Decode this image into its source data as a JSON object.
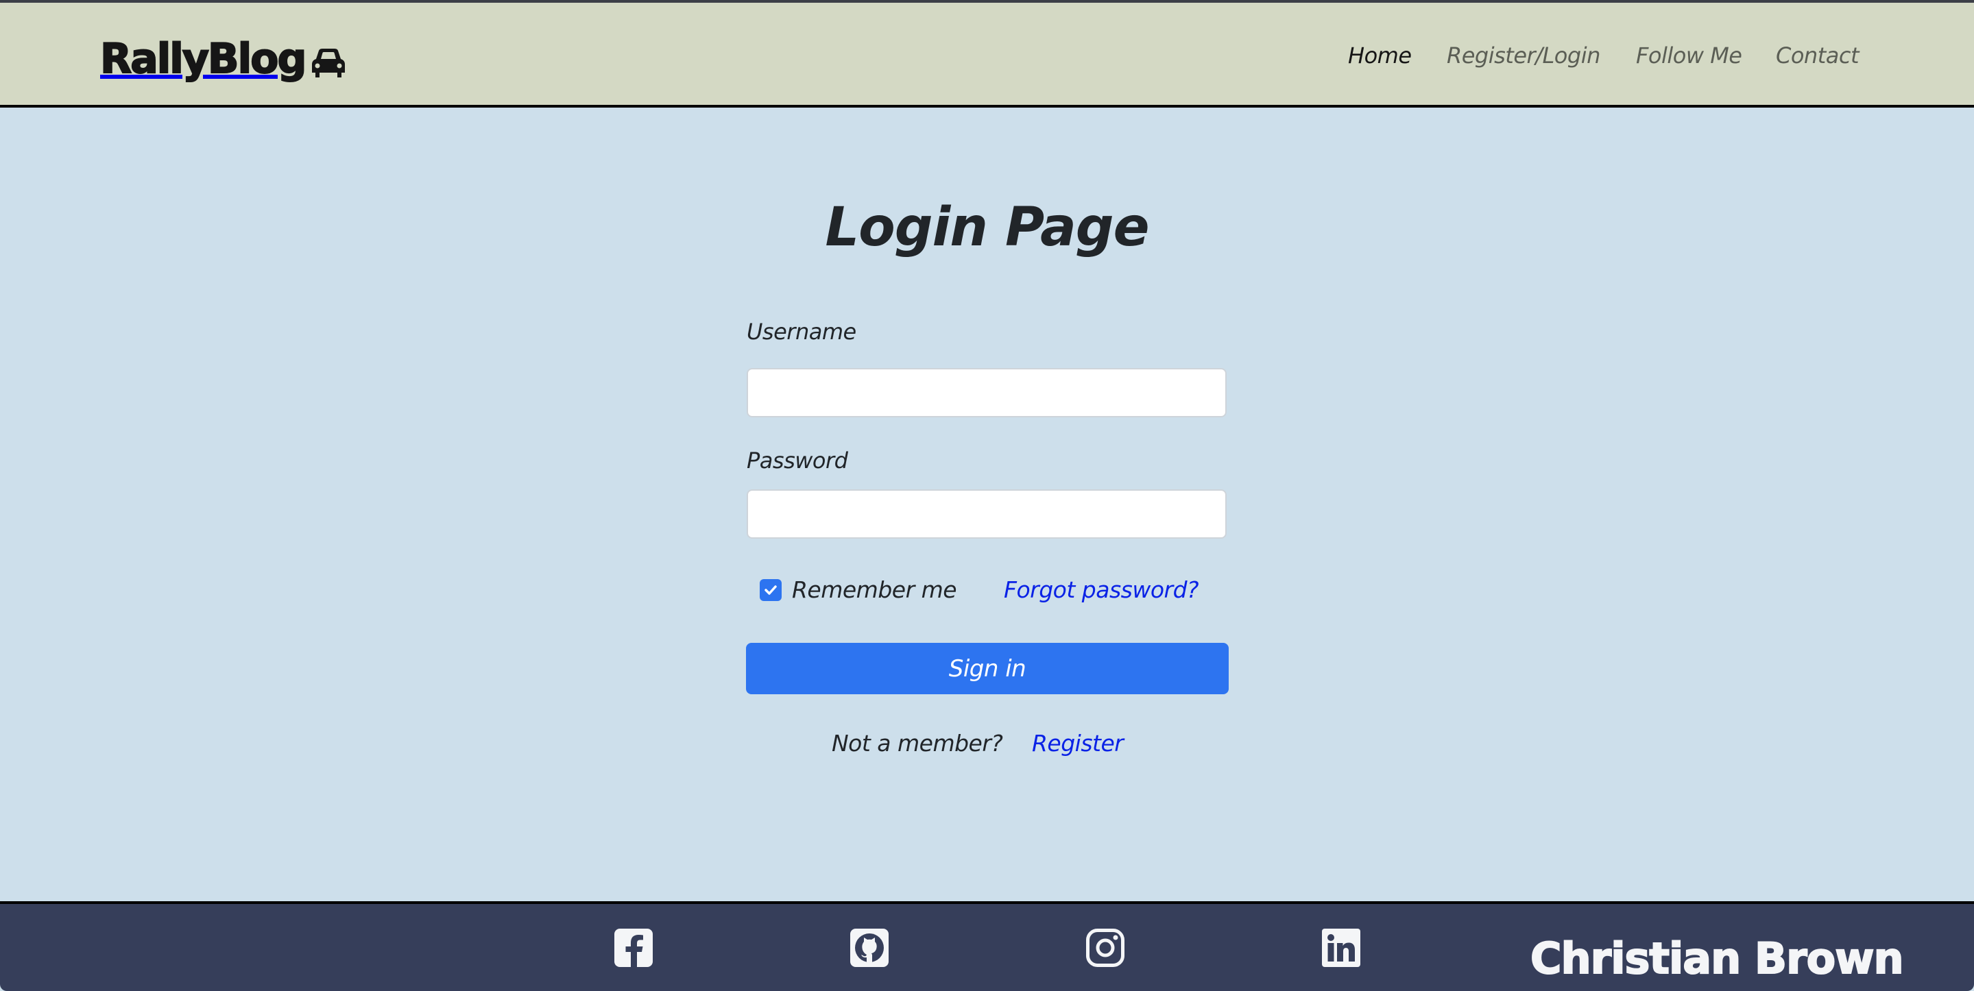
{
  "header": {
    "logo_text": "RallyBlog",
    "logo_icon": "car-icon",
    "nav": [
      {
        "label": "Home",
        "active": true
      },
      {
        "label": "Register/Login",
        "active": false
      },
      {
        "label": "Follow Me",
        "active": false
      },
      {
        "label": "Contact",
        "active": false
      }
    ]
  },
  "main": {
    "title": "Login Page",
    "username": {
      "label": "Username",
      "value": "",
      "placeholder": ""
    },
    "password": {
      "label": "Password",
      "value": "",
      "placeholder": ""
    },
    "remember_me": {
      "label": "Remember me",
      "checked": true
    },
    "forgot_password": "Forgot password?",
    "sign_in": "Sign in",
    "not_member": "Not a member?",
    "register": "Register"
  },
  "footer": {
    "social": [
      {
        "name": "facebook-icon"
      },
      {
        "name": "github-icon"
      },
      {
        "name": "instagram-icon"
      },
      {
        "name": "linkedin-icon"
      }
    ],
    "owner_name": "Christian Brown"
  },
  "colors": {
    "header_bg": "#d4d9c4",
    "page_bg": "#cddfeb",
    "footer_bg": "#363e5a",
    "primary": "#2d74f0",
    "link": "#0a22e6"
  }
}
